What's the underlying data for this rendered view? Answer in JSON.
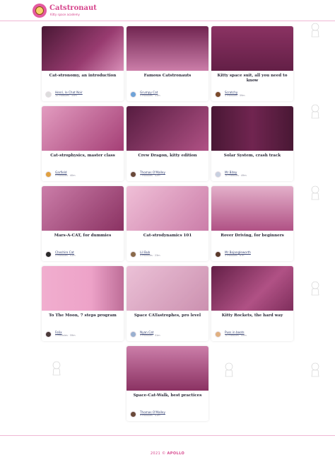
{
  "header": {
    "brand": "Catstronaut",
    "tagline": "Kitty space academy",
    "accent": "#d6458c"
  },
  "tracks": [
    {
      "title": "Cat-stronomy, an introduction",
      "author": "Henri, le Chat Noir",
      "info": "10 modules · 59m",
      "icon": "cat-galaxy-image",
      "theme": "#5a1f44"
    },
    {
      "title": "Famous Catstronauts",
      "author": "Grumpy Cat",
      "info": "5 modules · 31m",
      "icon": "cat-astronauts-image",
      "theme": "#7a2f5a"
    },
    {
      "title": "Kitty space suit, all you need to know",
      "author": "Scratchy",
      "info": "5 modules · 59m",
      "icon": "cat-helmets-image",
      "theme": "#6b2a52"
    },
    {
      "title": "Cat-strophysics, master class",
      "author": "Garfield",
      "info": "9 modules · 40m",
      "icon": "cat-suit-planets-image",
      "theme": "#d98fb8"
    },
    {
      "title": "Crew Dragon, kitty edition",
      "author": "Thomas O'Malley",
      "info": "7 modules · 42m",
      "icon": "cat-rocket-image",
      "theme": "#5a1f44"
    },
    {
      "title": "Solar System, crash track",
      "author": "Mr Bitey",
      "info": "10 modules · 49m",
      "icon": "cat-planets-image",
      "theme": "#3a1430"
    },
    {
      "title": "Mars-A-CAT, for dummies",
      "author": "Cheshire Cat",
      "info": "5 modules · 41m",
      "icon": "cat-face-image",
      "theme": "#a85584"
    },
    {
      "title": "Cat-strodynamics 101",
      "author": "Lil Bub",
      "info": "4 modules · 23m",
      "icon": "cat-lying-image",
      "theme": "#e8b8d2"
    },
    {
      "title": "Rover Driving, for beginners",
      "author": "Mr Bojangleworth",
      "info": "5 modules · 6 m",
      "icon": "cat-rover-image",
      "theme": "#b9789c"
    },
    {
      "title": "To The Moon, 7 steps program",
      "author": "Felix",
      "info": "5 modules · 59m",
      "icon": "cat-profile-image",
      "theme": "#f2b8d6"
    },
    {
      "title": "Space CATastrophes, pro level",
      "author": "Nyan Cat",
      "info": "5 modules · 31m",
      "icon": "white-cat-image",
      "theme": "#e7d0dc"
    },
    {
      "title": "Kitty Rockets, the hard way",
      "author": "Puss in boots",
      "info": "10 modules · 49m",
      "icon": "kitten-image",
      "theme": "#6b2a52"
    },
    {
      "title": "Space-Cat-Walk, best practices",
      "author": "Thomas O'Malley",
      "info": "9 modules · 41m",
      "icon": "cat-walking-image",
      "theme": "#9a4a78"
    }
  ],
  "footer": {
    "year": "2021 ©",
    "brand": "APOLLO"
  }
}
